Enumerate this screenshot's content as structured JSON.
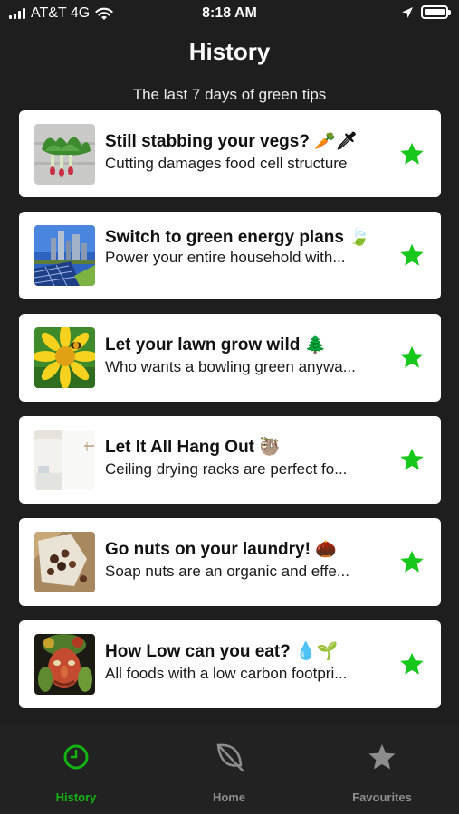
{
  "status": {
    "carrier": "AT&T 4G",
    "time": "8:18 AM"
  },
  "header": {
    "title": "History",
    "subtitle": "The last 7 days of green tips"
  },
  "tips": [
    {
      "title": "Still stabbing your vegs? 🥕🗡",
      "subtitle": "Cutting damages food cell structure",
      "thumb": "vegetables-image",
      "favourite": true
    },
    {
      "title": "Switch to green energy plans 🍃",
      "subtitle": "Power your entire household with...",
      "thumb": "solar-city-image",
      "favourite": true
    },
    {
      "title": "Let your lawn grow wild 🌲",
      "subtitle": "Who wants a bowling green anywa...",
      "thumb": "sunflower-bee-image",
      "favourite": true
    },
    {
      "title": "Let It All Hang Out 🦥",
      "subtitle": "Ceiling drying racks are perfect fo...",
      "thumb": "drying-rack-image",
      "favourite": true
    },
    {
      "title": "Go nuts on your laundry! 🌰",
      "subtitle": "Soap nuts are an organic and effe...",
      "thumb": "soap-nuts-image",
      "favourite": true
    },
    {
      "title": "How Low can you eat? 💧🌱",
      "subtitle": "All foods with a low carbon footpri...",
      "thumb": "vegetable-face-image",
      "favourite": true
    }
  ],
  "tabs": [
    {
      "label": "History",
      "icon": "clock-icon",
      "active": true
    },
    {
      "label": "Home",
      "icon": "leaf-icon",
      "active": false
    },
    {
      "label": "Favourites",
      "icon": "star-icon",
      "active": false
    }
  ],
  "colors": {
    "accent": "#13b313",
    "star": "#18c71c",
    "background": "#1e1e1e",
    "card": "#ffffff",
    "tab_inactive": "#8d8d8d"
  }
}
